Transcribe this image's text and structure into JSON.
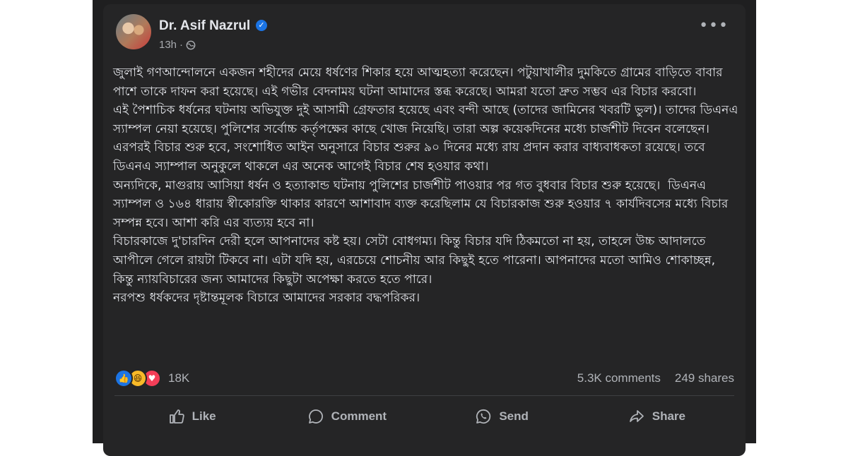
{
  "post": {
    "author": "Dr. Asif Nazrul",
    "time": "13h",
    "separator": "·",
    "body": [
      "জুলাই গণআন্দোলনে একজন শহীদের মেয়ে ধর্ষণের শিকার হয়ে আত্মহত্যা করেছেন। পটুয়াখালীর দুমকিতে গ্রামের বাড়িতে বাবার পাশে তাকে দাফন করা হয়েছে। এই গভীর বেদনাময় ঘটনা আমাদের স্তব্ধ করেছে। আমরা যতো দ্রুত সম্ভব এর বিচার করবো।",
      "এই পৈশাচিক ধর্ষনের ঘটনায় অভিযুক্ত দুই আসামী গ্রেফতার হয়েছে এবং বন্দী আছে (তাদের জামিনের খবরটি ভুল)। তাদের ডিএনএ স্যাম্পল নেয়া হয়েছে। পুলিশের সর্বোচ্চ কর্তৃপক্ষের কাছে খোজ নিয়েছি। তারা অল্প কয়েকদিনের মধ্যে চার্জশীট দিবেন বলেছেন। এরপরই বিচার শুরু হবে, সংশোধিত আইন অনুসারে বিচার শুরুর ৯০ দিনের মধ্যে রায় প্রদান করার বাধ্যবাধকতা রয়েছে। তবে ডিএনএ স্যাম্পাল অনুকুলে থাকলে এর অনেক আগেই বিচার শেষ হওয়ার কথা।",
      "অন্যদিকে, মাগুরায় আসিয়া ধর্ষন ও হত্যাকান্ড ঘটনায় পুলিশের চার্জশীট পাওয়ার পর গত বুধবার বিচার শুরু হয়েছে।  ডিএনএ স্যাম্পল ও ১৬৪ ধারায় স্বীকোরক্তি থাকার কারণে আশাবাদ ব্যক্ত করেছিলাম যে বিচারকাজ শুরু হওয়ার ৭ কার্যদিবসের মধ্যে বিচার সম্পন্ন হবে। আশা করি এর ব্যত্যয় হবে না।",
      "বিচারকাজে দু'চারদিন দেরী হলে আপনাদের কষ্ট হয়। সেটা বোধগম্য। কিন্তু বিচার যদি ঠিকমতো না হয়, তাহলে উচ্চ আদালতে আপীলে গেলে রায়টা টিকবে না। এটা যদি হয়, এরচেয়ে শোচনীয় আর কিছুই হতে পারেনা। আপনাদের মতো আমিও শোকাচ্ছন্ন, কিন্তু ন্যায়বিচারের জন্য আমাদের কিছুটা অপেক্ষা করতে হতে পারে।",
      "নরপশু ধর্ষকদের দৃষ্টান্তমূলক বিচারে আমাদের সরকার বদ্ধপরিকর।"
    ],
    "reaction_count": "18K",
    "comments": "5.3K comments",
    "shares": "249 shares"
  },
  "actions": {
    "like": "Like",
    "comment": "Comment",
    "send": "Send",
    "share": "Share"
  },
  "icons": {
    "verified": "verified-badge-icon",
    "privacy": "globe-icon",
    "more": "more-options-icon"
  },
  "colors": {
    "card": "#252526",
    "text": "#e4e6eb",
    "muted": "#b0b3b8",
    "accent": "#1b74e4"
  }
}
